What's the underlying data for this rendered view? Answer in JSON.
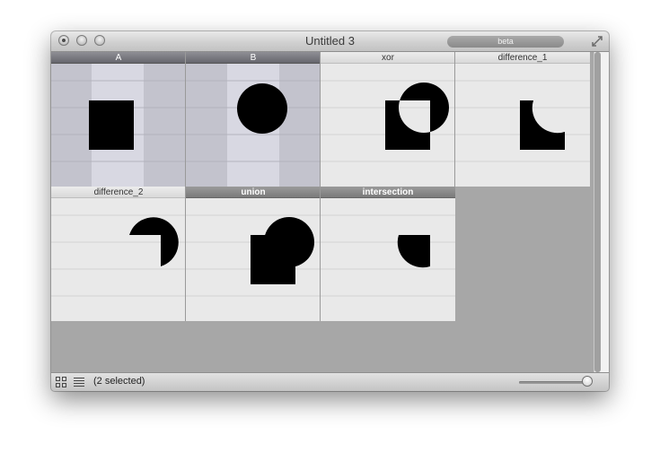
{
  "window": {
    "title": "Untitled 3",
    "badge": "beta"
  },
  "cells": [
    {
      "label": "A",
      "state": "selected"
    },
    {
      "label": "B",
      "state": "selected"
    },
    {
      "label": "xor",
      "state": "normal"
    },
    {
      "label": "difference_1",
      "state": "normal"
    },
    {
      "label": "difference_2",
      "state": "normal"
    },
    {
      "label": "union",
      "state": "bold"
    },
    {
      "label": "intersection",
      "state": "bold"
    }
  ],
  "status": {
    "selection_text": "(2 selected)"
  },
  "zoom": {
    "level": 1.0
  },
  "icons": {
    "view_grid": "grid-view-icon",
    "view_list": "list-view-icon",
    "fullscreen": "fullscreen-icon"
  },
  "colors": {
    "selected_header": "#66666d",
    "selected_background": "#c3c3cd",
    "selected_center_band": "#d8d8e2",
    "cell_background": "#e9e9e9",
    "shape_fill": "#000000",
    "empty_area": "#a7a7a7"
  }
}
